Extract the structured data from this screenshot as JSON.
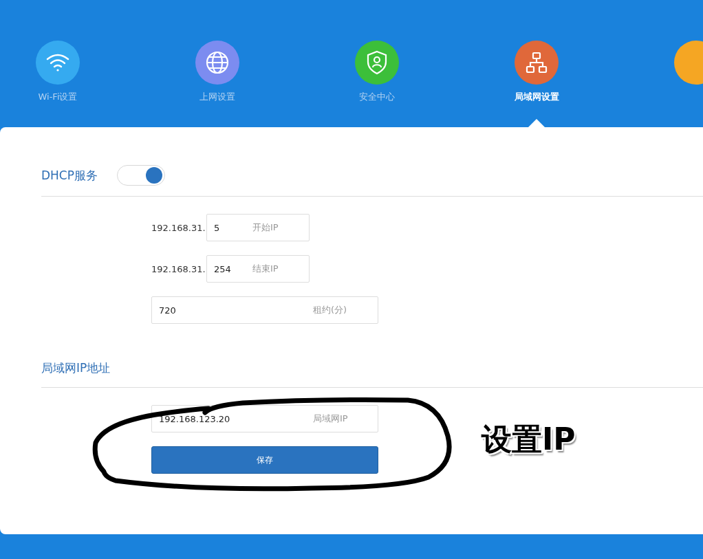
{
  "nav": [
    {
      "kind": "wifi",
      "label": "Wi-Fi设置",
      "color": "#35aaf0",
      "selected": false
    },
    {
      "kind": "globe",
      "label": "上网设置",
      "color": "#7c8cf0",
      "selected": false
    },
    {
      "kind": "shield",
      "label": "安全中心",
      "color": "#3cbf3a",
      "selected": false
    },
    {
      "kind": "network",
      "label": "局域网设置",
      "color": "#e0683a",
      "selected": true
    },
    {
      "kind": "cut",
      "color": "#f5a623",
      "selected": false
    }
  ],
  "dhcp": {
    "title": "DHCP服务",
    "on": true,
    "fields": [
      {
        "kind": "ip",
        "prefix": "192.168.31.",
        "value": "5",
        "label": "开始IP"
      },
      {
        "kind": "ip",
        "prefix": "192.168.31.",
        "value": "254",
        "label": "结束IP"
      },
      {
        "kind": "wide",
        "value": "720",
        "label": "租约(分)"
      }
    ]
  },
  "lan": {
    "title": "局域网IP地址",
    "value": "192.168.123.20",
    "label": "局域网IP",
    "button": "保存"
  },
  "annotation": {
    "text": "设置IP"
  }
}
